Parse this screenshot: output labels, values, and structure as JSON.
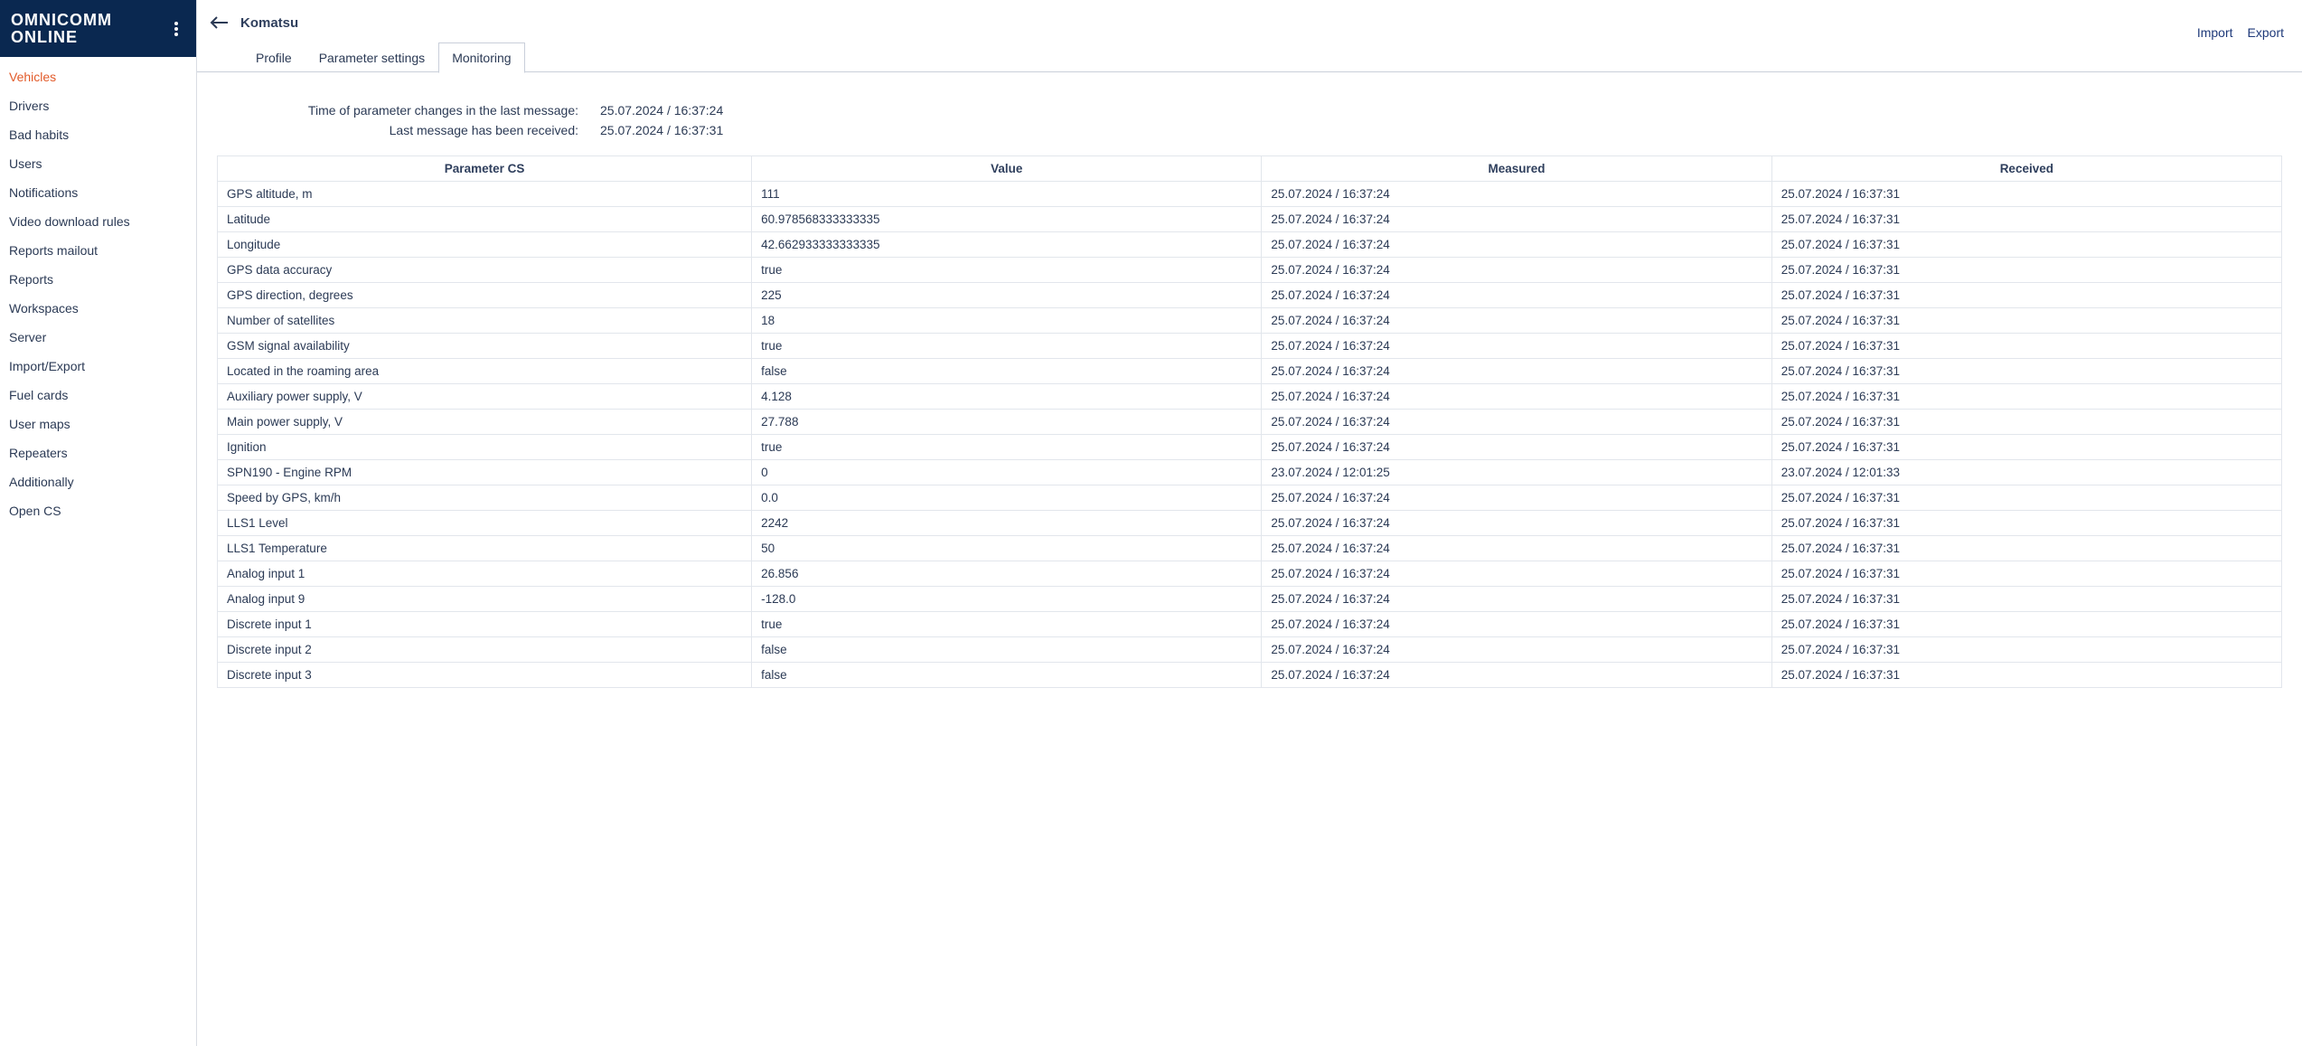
{
  "brand": {
    "line1": "OMNICOMM",
    "line2": "ONLINE"
  },
  "sidebar": {
    "items": [
      "Vehicles",
      "Drivers",
      "Bad habits",
      "Users",
      "Notifications",
      "Video download rules",
      "Reports mailout",
      "Reports",
      "Workspaces",
      "Server",
      "Import/Export",
      "Fuel cards",
      "User maps",
      "Repeaters",
      "Additionally",
      "Open CS"
    ],
    "active_index": 0
  },
  "header": {
    "vehicle": "Komatsu",
    "tabs": [
      "Profile",
      "Parameter settings",
      "Monitoring"
    ],
    "active_tab_index": 2,
    "actions": {
      "import": "Import",
      "export": "Export"
    }
  },
  "meta": {
    "param_change_label": "Time of parameter changes in the last message:",
    "param_change_value": "25.07.2024 / 16:37:24",
    "last_msg_label": "Last message has been received:",
    "last_msg_value": "25.07.2024 / 16:37:31"
  },
  "table": {
    "headers": {
      "param": "Parameter CS",
      "value": "Value",
      "measured": "Measured",
      "received": "Received"
    },
    "rows": [
      {
        "param": "GPS altitude, m",
        "value": "111",
        "measured": "25.07.2024 / 16:37:24",
        "received": "25.07.2024 / 16:37:31"
      },
      {
        "param": "Latitude",
        "value": "60.978568333333335",
        "measured": "25.07.2024 / 16:37:24",
        "received": "25.07.2024 / 16:37:31"
      },
      {
        "param": "Longitude",
        "value": "42.662933333333335",
        "measured": "25.07.2024 / 16:37:24",
        "received": "25.07.2024 / 16:37:31"
      },
      {
        "param": "GPS data accuracy",
        "value": "true",
        "measured": "25.07.2024 / 16:37:24",
        "received": "25.07.2024 / 16:37:31"
      },
      {
        "param": "GPS direction, degrees",
        "value": "225",
        "measured": "25.07.2024 / 16:37:24",
        "received": "25.07.2024 / 16:37:31"
      },
      {
        "param": "Number of satellites",
        "value": "18",
        "measured": "25.07.2024 / 16:37:24",
        "received": "25.07.2024 / 16:37:31"
      },
      {
        "param": "GSM signal availability",
        "value": "true",
        "measured": "25.07.2024 / 16:37:24",
        "received": "25.07.2024 / 16:37:31"
      },
      {
        "param": "Located in the roaming area",
        "value": "false",
        "measured": "25.07.2024 / 16:37:24",
        "received": "25.07.2024 / 16:37:31"
      },
      {
        "param": "Auxiliary power supply, V",
        "value": "4.128",
        "measured": "25.07.2024 / 16:37:24",
        "received": "25.07.2024 / 16:37:31"
      },
      {
        "param": "Main power supply, V",
        "value": "27.788",
        "measured": "25.07.2024 / 16:37:24",
        "received": "25.07.2024 / 16:37:31"
      },
      {
        "param": "Ignition",
        "value": "true",
        "measured": "25.07.2024 / 16:37:24",
        "received": "25.07.2024 / 16:37:31"
      },
      {
        "param": "SPN190 - Engine RPM",
        "value": "0",
        "measured": "23.07.2024 / 12:01:25",
        "received": "23.07.2024 / 12:01:33"
      },
      {
        "param": "Speed by GPS, km/h",
        "value": "0.0",
        "measured": "25.07.2024 / 16:37:24",
        "received": "25.07.2024 / 16:37:31"
      },
      {
        "param": "LLS1 Level",
        "value": "2242",
        "measured": "25.07.2024 / 16:37:24",
        "received": "25.07.2024 / 16:37:31"
      },
      {
        "param": "LLS1 Temperature",
        "value": "50",
        "measured": "25.07.2024 / 16:37:24",
        "received": "25.07.2024 / 16:37:31"
      },
      {
        "param": "Analog input 1",
        "value": "26.856",
        "measured": "25.07.2024 / 16:37:24",
        "received": "25.07.2024 / 16:37:31"
      },
      {
        "param": "Analog input 9",
        "value": "-128.0",
        "measured": "25.07.2024 / 16:37:24",
        "received": "25.07.2024 / 16:37:31"
      },
      {
        "param": "Discrete input 1",
        "value": "true",
        "measured": "25.07.2024 / 16:37:24",
        "received": "25.07.2024 / 16:37:31"
      },
      {
        "param": "Discrete input 2",
        "value": "false",
        "measured": "25.07.2024 / 16:37:24",
        "received": "25.07.2024 / 16:37:31"
      },
      {
        "param": "Discrete input 3",
        "value": "false",
        "measured": "25.07.2024 / 16:37:24",
        "received": "25.07.2024 / 16:37:31"
      }
    ]
  }
}
